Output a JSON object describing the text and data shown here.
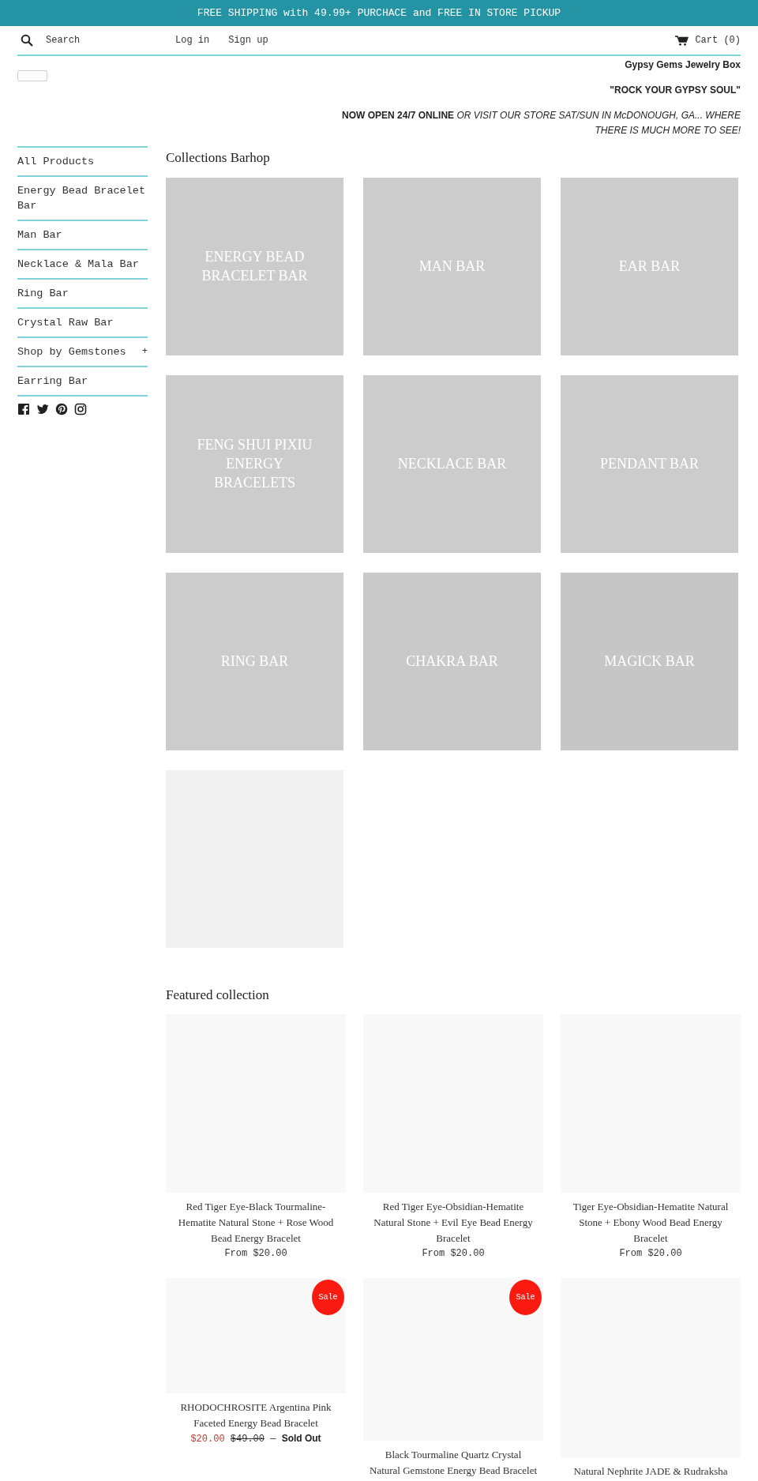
{
  "announcement": "FREE SHIPPING with 49.99+ PURCHACE and FREE IN STORE PICKUP",
  "header": {
    "search": {
      "placeholder": "Search"
    },
    "links": [
      "Log in",
      "Sign up"
    ],
    "cart": "Cart (0)"
  },
  "intro": {
    "store_name": "Gypsy Gems Jewelry Box",
    "slogan": "\"ROCK YOUR GYPSY SOUL\"",
    "notice": "**NOW OPEN 24/7 ONLINE** *OR VISIT OUR STORE SAT/SUN IN McDONOUGH, GA... WHERE THERE IS MUCH MORE TO SEE!*"
  },
  "sidebar": {
    "items": [
      {
        "label": "All Products"
      },
      {
        "label": "Energy Bead Bracelet Bar"
      },
      {
        "label": "Man Bar"
      },
      {
        "label": "Necklace & Mala Bar"
      },
      {
        "label": "Ring Bar"
      },
      {
        "label": "Crystal Raw Bar"
      },
      {
        "label": "Shop by Gemstones",
        "toggle": "+"
      },
      {
        "label": "Earring Bar"
      }
    ]
  },
  "collections": {
    "title": "Collections Barhop",
    "tiles": [
      {
        "label": "ENERGY BEAD BRACELET BAR",
        "color": "#cccccc"
      },
      {
        "label": "MAN BAR",
        "color": "#cccccc"
      },
      {
        "label": "EAR BAR",
        "color": "#cccccc"
      },
      {
        "label": "FENG SHUI PIXIU ENERGY BRACELETS",
        "color": "#cccccc"
      },
      {
        "label": "NECKLACE BAR",
        "color": "#cccccc"
      },
      {
        "label": "PENDANT BAR",
        "color": "#cccccc"
      },
      {
        "label": "RING BAR",
        "color": "#cccccc"
      },
      {
        "label": "CHAKRA BAR",
        "color": "#c9c9c9"
      },
      {
        "label": "MAGICK BAR",
        "color": "#c6c6c6"
      },
      {
        "color": "#f1f1f1"
      }
    ]
  },
  "featured": {
    "title": "Featured collection",
    "products": [
      {
        "name": "Red Tiger Eye-Black Tourmaline-Hematite Natural Stone + Rose Wood Bead Energy Bracelet",
        "sale": false,
        "price": "From $20.00"
      },
      {
        "name": "Red Tiger Eye-Obsidian-Hematite Natural Stone + Evil Eye Bead Energy Bracelet",
        "sale": false,
        "price": "From $20.00"
      },
      {
        "name": "Tiger Eye-Obsidian-Hematite Natural Stone + Ebony Wood Bead Energy Bracelet",
        "sale": false,
        "price": "From $20.00"
      },
      {
        "name": "RHODOCHROSITE Argentina Pink Faceted Energy Bead Bracelet",
        "sale": true,
        "badge": "Sale",
        "sale_price": "$20.00",
        "compare_price": "$49.00",
        "separator": "—",
        "sold_out": "Sold Out"
      },
      {
        "name": "Black Tourmaline Quartz Crystal Natural Gemstone Energy Bead Bracelet",
        "sale": true,
        "badge": "Sale"
      },
      {
        "name": "Natural Nephrite JADE & Rudraksha",
        "sale": false
      }
    ]
  }
}
